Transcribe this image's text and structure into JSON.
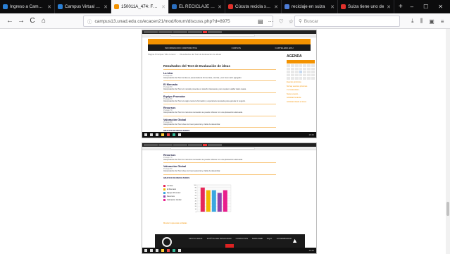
{
  "browser": {
    "tabs": [
      {
        "title": "Ingreso a Campus",
        "color": "#2a7fd4"
      },
      {
        "title": "Campus Virtual - U",
        "color": "#2a7fd4"
      },
      {
        "title": "150011A_474: Foro",
        "color": "#f39200",
        "active": true
      },
      {
        "title": "EL RECICLAJE DE LA",
        "color": "#2b6fbf"
      },
      {
        "title": "Cúcuta recicla solo",
        "color": "#e0312b"
      },
      {
        "title": "reciclaje en suiza",
        "color": "#4d7cd6"
      },
      {
        "title": "Suiza tiene uno de",
        "color": "#e0312b"
      }
    ],
    "new_tab": "+",
    "window_controls": [
      "–",
      "☐",
      "✕"
    ],
    "nav": {
      "back": "←",
      "forward": "→",
      "reload": "C",
      "home": "⌂"
    },
    "url": "campus13.unad.edu.co/ecacen21/mod/forum/discuss.php?d=8975",
    "search_placeholder": "Buscar",
    "url_actions": [
      "▤",
      "···",
      "♡",
      "☆"
    ],
    "toolbar_right": [
      "⤓",
      "⫼",
      "▣",
      "≡"
    ]
  },
  "page_top": {
    "menu": [
      "INFORMACION CORPORATIVA",
      "CURSOS",
      "CARTELERA EDU"
    ],
    "breadcrumb": "Página Principal / Mis cursos / ... / Resultados del Test de Evaluación de ideas",
    "title": "Resultados del Test de Evaluación de ideas",
    "sections": [
      {
        "head": "La idea",
        "meta": "Puntaje 90",
        "body": "Interpretación del Test: la idea es presentada de forma clara, concisa y con buen valor agregado."
      },
      {
        "head": "El Mercado",
        "meta": "Puntaje 80",
        "body": "Interpretación del Test: el mercado presenta un tamaño interesante, pero requiere validar datos reales."
      },
      {
        "head": "Equipo Promotor",
        "meta": "Puntaje 80",
        "body": "Interpretación del Test: el equipo reúne la formación y experiencia necesaria para ejecutar el negocio."
      },
      {
        "head": "Recursos",
        "meta": "Puntaje 70",
        "body": "Interpretación del Test: los recursos necesarios se pueden obtener con una planeación adecuada."
      },
      {
        "head": "Valoración Global",
        "meta": "Puntaje 80",
        "body": "Interpretación del Test: idea con buen potencial y viable de desarrollar."
      }
    ],
    "footer_caption": "GRAFICO DE RESULTADOS",
    "agenda_title": "AGENDA",
    "side_links": [
      "Eventos próximos",
      "No hay eventos próximos",
      "Ir al calendario...",
      "Nuevo evento...",
      "Actividad reciente",
      "Actividad desde el lunes"
    ]
  },
  "page_bottom": {
    "sections": [
      {
        "head": "Recursos",
        "meta": "Puntaje 70",
        "body": "Interpretación del Test: los recursos necesarios se pueden obtener con una planeación adecuada."
      },
      {
        "head": "Valoración Global",
        "meta": "Puntaje 80",
        "body": "Interpretación del Test: idea con buen potencial y viable de desarrollar."
      }
    ],
    "caption": "GRAFICO DE RESULTADOS",
    "legend": [
      {
        "name": "La idea",
        "color": "#e6285a"
      },
      {
        "name": "El Mercado",
        "color": "#f2b800"
      },
      {
        "name": "Equipo Promotor",
        "color": "#3aa7e0"
      },
      {
        "name": "Recursos",
        "color": "#8e44ad"
      },
      {
        "name": "Valoración Global",
        "color": "#e91e8c"
      }
    ],
    "reply_link": "Mostrar respuestas anidadas",
    "footer_links": [
      "APOYO LEGAL",
      "POLÍTICA DE PRIVACIDAD",
      "CONTACTOS",
      "MAPA WEB",
      "P.Q.R.",
      "ACCESIBILIDAD"
    ]
  },
  "chart_data": {
    "type": "bar",
    "categories": [
      "La idea",
      "El Mercado",
      "Equipo Promotor",
      "Recursos",
      "Valoración Global"
    ],
    "values": [
      90,
      80,
      80,
      70,
      80
    ],
    "colors": [
      "#e6285a",
      "#f2b800",
      "#3aa7e0",
      "#8e44ad",
      "#e91e8c"
    ],
    "ylim": [
      0,
      100
    ],
    "title": "",
    "xlabel": "",
    "ylabel": ""
  },
  "taskbar": {
    "clock": "10:42"
  }
}
